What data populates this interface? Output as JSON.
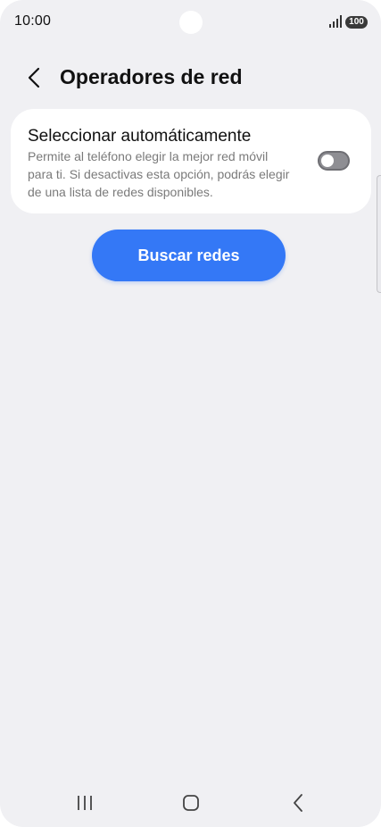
{
  "status_bar": {
    "time": "10:00",
    "battery": "100",
    "icons": [
      "signal-icon",
      "battery-icon"
    ]
  },
  "header": {
    "back_icon": "chevron-left-icon",
    "title": "Operadores de red"
  },
  "auto_select": {
    "title": "Seleccionar automáticamente",
    "description": "Permite al teléfono elegir la mejor red móvil para ti. Si desactivas esta opción, podrás elegir de una lista de redes disponibles.",
    "enabled": false
  },
  "search_button": {
    "label": "Buscar redes"
  },
  "nav_bar": {
    "icons": [
      "recents-icon",
      "home-icon",
      "back-icon"
    ]
  },
  "colors": {
    "background": "#f0f0f3",
    "card": "#ffffff",
    "accent": "#3478f6",
    "toggle_off": "#8e8e93",
    "secondary_text": "#7a7a7a"
  }
}
